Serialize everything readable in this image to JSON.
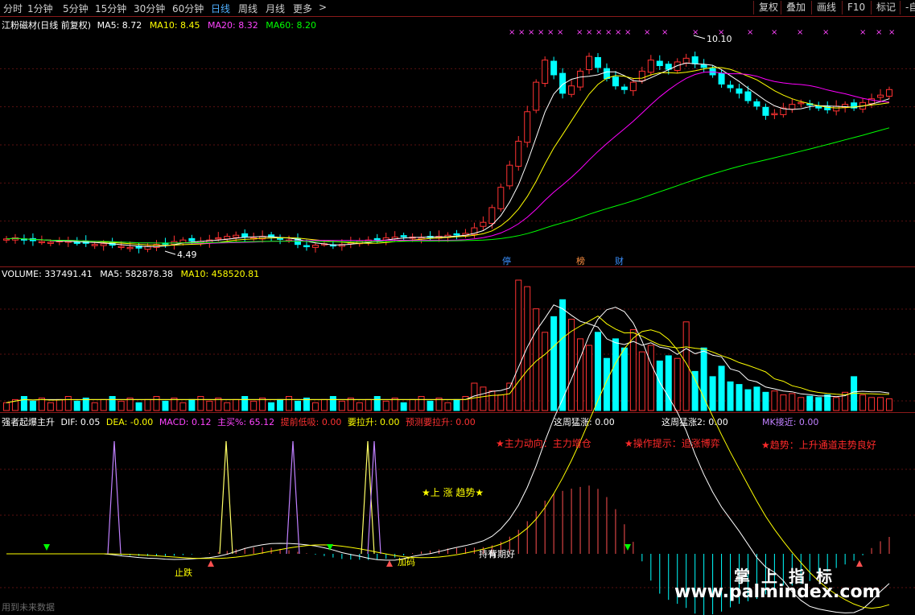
{
  "toolbar": {
    "periods": [
      "分时",
      "1分钟",
      "5分钟",
      "15分钟",
      "30分钟",
      "60分钟",
      "日线",
      "周线",
      "月线",
      "更多"
    ],
    "active": "日线",
    "more_arrow": ">",
    "right_buttons": [
      "复权",
      "叠加",
      "画线",
      "F10",
      "标记",
      "-自"
    ]
  },
  "price_panel": {
    "title": "江粉磁材(日线 前复权)",
    "ma5": "MA5: 8.72",
    "ma10": "MA10: 8.45",
    "ma20": "MA20: 8.32",
    "ma60": "MA60: 8.20",
    "high_label": "10.10",
    "low_label": "4.49",
    "markers": [
      "停",
      "榜",
      "财"
    ],
    "colors": {
      "ma5": "#ffffff",
      "ma10": "#ffff00",
      "ma20": "#ff00ff",
      "ma60": "#00ff00",
      "up": "#ff3232",
      "down": "#00ffff"
    }
  },
  "volume_panel": {
    "volume": "VOLUME: 337491.41",
    "ma5": "MA5: 582878.38",
    "ma10": "MA10: 458520.81"
  },
  "indicator_panel": {
    "name": "强者起爆主升",
    "dif": "DIF: 0.05",
    "dea": "DEA: -0.00",
    "macd": "MACD: 0.12",
    "main_buy": "主买%: 65.12",
    "low_buy": "提前低吸: 0.00",
    "must_rise": "要拉升: 0.00",
    "pre_rise": "预测要拉升: 0.00",
    "week_up": "这周猛涨: 0.00",
    "week_up2": "这周猛涨2: 0.00",
    "mk": "MK接近: 0.00",
    "annot_main": "★主力动向：主力增仓",
    "annot_op": "★操作提示：追涨博弈",
    "annot_trend": "★趋势：上升通道走势良好",
    "annot_up": "★上 涨 趋势★",
    "tag_stop": "止跌",
    "tag_add": "加码",
    "tag_hold": "持有",
    "tag_good": "背期好"
  },
  "footer": {
    "note": "用到未来数据"
  },
  "watermark": {
    "line1": "掌上指标",
    "line2": "www.palmindex.com"
  },
  "chart_data": {
    "type": "candlestick",
    "series": [
      {
        "name": "close",
        "values": [
          4.75,
          4.78,
          4.72,
          4.7,
          4.68,
          4.66,
          4.7,
          4.69,
          4.65,
          4.63,
          4.6,
          4.62,
          4.58,
          4.55,
          4.52,
          4.5,
          4.55,
          4.6,
          4.63,
          4.68,
          4.72,
          4.7,
          4.68,
          4.72,
          4.78,
          4.82,
          4.85,
          4.8,
          4.78,
          4.82,
          4.8,
          4.75,
          4.72,
          4.6,
          4.55,
          4.58,
          4.62,
          4.58,
          4.6,
          4.65,
          4.7,
          4.72,
          4.75,
          4.78,
          4.8,
          4.82,
          4.8,
          4.78,
          4.8,
          4.82,
          4.85,
          4.88,
          4.9,
          5.05,
          5.2,
          5.6,
          6.15,
          6.75,
          7.4,
          8.2,
          9.0,
          9.6,
          9.2,
          8.7,
          8.9,
          9.3,
          9.7,
          9.4,
          9.1,
          8.9,
          8.8,
          9.0,
          9.3,
          9.6,
          9.45,
          9.35,
          9.55,
          9.65,
          9.5,
          9.4,
          9.2,
          8.95,
          8.85,
          8.7,
          8.5,
          8.35,
          8.1,
          8.15,
          8.3,
          8.4,
          8.45,
          8.38,
          8.3,
          8.25,
          8.35,
          8.4,
          8.3,
          8.45,
          8.55,
          8.65,
          8.8
        ]
      }
    ],
    "annotations": [
      "10.10",
      "4.49"
    ]
  }
}
